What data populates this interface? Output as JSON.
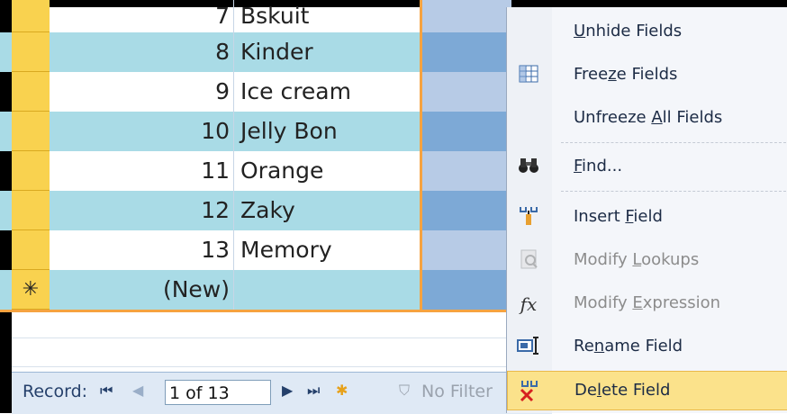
{
  "rows": [
    {
      "id": "7",
      "name": "Bskuit",
      "alt": false
    },
    {
      "id": "8",
      "name": "Kinder",
      "alt": true
    },
    {
      "id": "9",
      "name": "Ice cream",
      "alt": false
    },
    {
      "id": "10",
      "name": "Jelly Bon",
      "alt": true
    },
    {
      "id": "11",
      "name": "Orange",
      "alt": false
    },
    {
      "id": "12",
      "name": "Zaky",
      "alt": true
    },
    {
      "id": "13",
      "name": "Memory",
      "alt": false
    },
    {
      "id": "(New)",
      "name": "",
      "alt": true,
      "new_marker": "✳"
    }
  ],
  "status": {
    "record_label": "Record:",
    "record_value": "1 of 13",
    "filter_label": "No Filter"
  },
  "menu": {
    "items": [
      {
        "label": "Unhide Fields",
        "icon": "",
        "disabled": false
      },
      {
        "label": "Freeze Fields",
        "icon": "freeze-grid-icon",
        "disabled": false
      },
      {
        "label": "Unfreeze All Fields",
        "icon": "",
        "disabled": false
      },
      {
        "label": "Find...",
        "icon": "binoculars-icon",
        "disabled": false
      },
      {
        "label": "Insert Field",
        "icon": "insert-column-icon",
        "disabled": false
      },
      {
        "label": "Modify Lookups",
        "icon": "lookup-icon",
        "disabled": true
      },
      {
        "label": "Modify Expression",
        "icon": "fx-icon",
        "disabled": true
      },
      {
        "label": "Rename Field",
        "icon": "rename-icon",
        "disabled": false
      },
      {
        "label": "Delete Field",
        "icon": "delete-column-icon",
        "disabled": false
      }
    ]
  },
  "colors": {
    "alt_row": "#a9dbe6",
    "plain_row": "#ffffff",
    "selector": "#f9d24f",
    "blue_alt": "#7da9d6",
    "blue_plain": "#b7cbe6",
    "highlight": "#fbe28b"
  }
}
